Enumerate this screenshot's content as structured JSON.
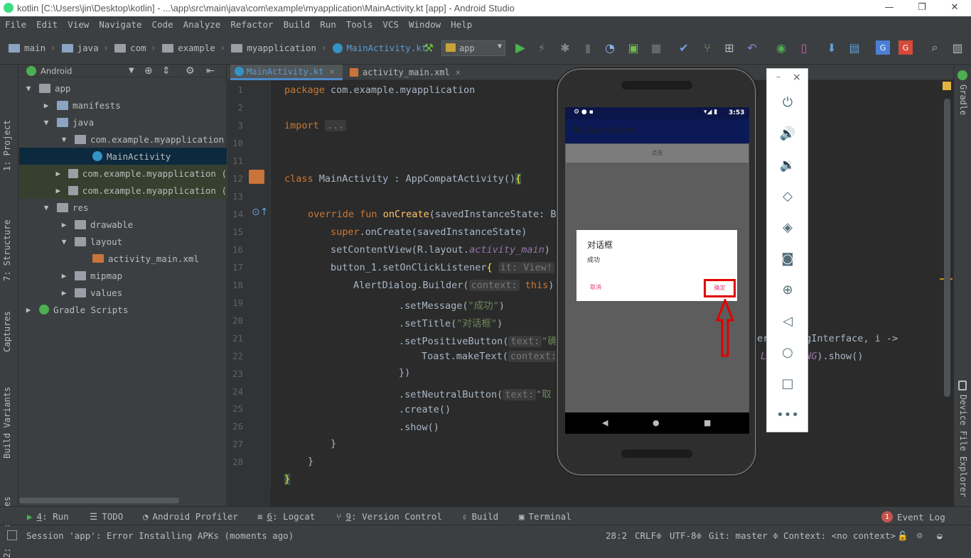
{
  "window": {
    "title": "kotlin [C:\\Users\\jin\\Desktop\\kotlin] - ...\\app\\src\\main\\java\\com\\example\\myapplication\\MainActivity.kt [app] - Android Studio",
    "minimize": "—",
    "maximize": "❐",
    "close": "✕"
  },
  "menu": [
    "File",
    "Edit",
    "View",
    "Navigate",
    "Code",
    "Analyze",
    "Refactor",
    "Build",
    "Run",
    "Tools",
    "VCS",
    "Window",
    "Help"
  ],
  "breadcrumb": [
    "main",
    "java",
    "com",
    "example",
    "myapplication",
    "MainActivity.kt"
  ],
  "run_config": "app",
  "project_panel": {
    "view_mode": "Android",
    "tree": [
      {
        "label": "app",
        "indent": 0,
        "arrow": "▼",
        "icon": "app"
      },
      {
        "label": "manifests",
        "indent": 1,
        "arrow": "▶",
        "icon": "folder"
      },
      {
        "label": "java",
        "indent": 1,
        "arrow": "▼",
        "icon": "folder"
      },
      {
        "label": "com.example.myapplication",
        "indent": 2,
        "arrow": "▼",
        "icon": "pkg"
      },
      {
        "label": "MainActivity",
        "indent": 3,
        "arrow": "",
        "icon": "cls"
      },
      {
        "label": "com.example.myapplication (",
        "indent": 2,
        "arrow": "▶",
        "icon": "pkg"
      },
      {
        "label": "com.example.myapplication (",
        "indent": 2,
        "arrow": "▶",
        "icon": "pkg"
      },
      {
        "label": "res",
        "indent": 1,
        "arrow": "▼",
        "icon": "res"
      },
      {
        "label": "drawable",
        "indent": 2,
        "arrow": "▶",
        "icon": "pkg"
      },
      {
        "label": "layout",
        "indent": 2,
        "arrow": "▼",
        "icon": "pkg"
      },
      {
        "label": "activity_main.xml",
        "indent": 3,
        "arrow": "",
        "icon": "xml"
      },
      {
        "label": "mipmap",
        "indent": 2,
        "arrow": "▶",
        "icon": "pkg"
      },
      {
        "label": "values",
        "indent": 2,
        "arrow": "▶",
        "icon": "pkg"
      },
      {
        "label": "Gradle Scripts",
        "indent": 0,
        "arrow": "▶",
        "icon": "gradle"
      }
    ]
  },
  "left_tools": [
    "1: Project",
    "7: Structure",
    "Captures",
    "Build Variants",
    "2: Favorites"
  ],
  "right_tools": [
    "Gradle",
    "Device File Explorer"
  ],
  "tabs": [
    {
      "label": "MainActivity.kt"
    },
    {
      "label": "activity_main.xml"
    }
  ],
  "line_numbers": [
    "1",
    "2",
    "3",
    "10",
    "11",
    "12",
    "13",
    "14",
    "15",
    "16",
    "17",
    "18",
    "19",
    "20",
    "21",
    "22",
    "23",
    "24",
    "25",
    "26",
    "27",
    "28"
  ],
  "code": {
    "l1_kw": "package",
    "l1_rest": " com.example.myapplication",
    "l3_kw": "import",
    "l3_fold": "...",
    "l11_kw": "class",
    "l11_rest": " MainActivity : AppCompatActivity()",
    "l11_brace": "{",
    "l13_kw": "override fun",
    "l13_fn": "onCreate",
    "l13_rest": "(savedInstanceState: Bu",
    "l14_kw": "super",
    "l14_rest": ".onCreate(savedInstanceState)",
    "l15_rest": "setContentView(R.layout.",
    "l15_it": "activity_main",
    "l15_end": ")",
    "l16_rest": "button_1.setOnClickListener",
    "l16_brace": "{",
    "l16_hint": "it: View!",
    "l17_rest": "AlertDialog.Builder(",
    "l17_hint": "context:",
    "l17_kw": "this",
    "l17_end": ")",
    "l18_rest": ".setMessage(",
    "l18_str": "\"成功\"",
    "l18_end": ")",
    "l19_rest": ".setTitle(",
    "l19_str": "\"对话框\"",
    "l19_end": ")",
    "l20_rest": ".setPositiveButton(",
    "l20_hint": "text:",
    "l20_str": "\"确",
    "l20_tail": "er",
    "l20_tail2": "ogInterface, i ->",
    "l21_rest": "Toast.makeText(",
    "l21_hint": "context:",
    "l21_tail": "L",
    "l21_tail2": "ONG).show()",
    "l22_rest": "})",
    "l23_rest": ".setNeutralButton(",
    "l23_hint": "text:",
    "l23_str": "\"取",
    "l24_rest": ".create()",
    "l25_rest": ".show()",
    "l26_rest": "}",
    "l27_rest": "}",
    "l28_rest": "}"
  },
  "emulator": {
    "status_time": "3:53",
    "app_title": "My Application",
    "button_text": "点击",
    "dialog_title": "对话框",
    "dialog_message": "成功",
    "negative_button": "取消",
    "positive_button": "确定",
    "nav_back": "◀",
    "nav_home": "●",
    "nav_recent": "■"
  },
  "emulator_toolbar": {
    "minimize": "–",
    "close": "×",
    "buttons": [
      "power-icon",
      "volume-up-icon",
      "volume-down-icon",
      "rotate-left-icon",
      "rotate-right-icon",
      "camera-icon",
      "zoom-icon",
      "back-icon",
      "home-icon",
      "overview-icon",
      "more-icon"
    ]
  },
  "bottom_tools": [
    {
      "num": "4",
      "label": ": Run"
    },
    {
      "num": "",
      "label": "TODO"
    },
    {
      "num": "",
      "label": "Android Profiler"
    },
    {
      "num": "6",
      "label": ": Logcat"
    },
    {
      "num": "9",
      "label": ": Version Control"
    },
    {
      "num": "",
      "label": "Build"
    },
    {
      "num": "",
      "label": "Terminal"
    }
  ],
  "event_log": {
    "count": "1",
    "label": "Event Log"
  },
  "status": {
    "message": "Session 'app': Error Installing APKs (moments ago)",
    "position": "28:2",
    "line_sep": "CRLF≑",
    "encoding": "UTF-8≑",
    "git": "Git: master ≑",
    "context": "Context: <no context>"
  },
  "colors": {
    "accent": "#4a88c7",
    "highlight": "#e10000",
    "appbar": "#0c1d5f"
  }
}
